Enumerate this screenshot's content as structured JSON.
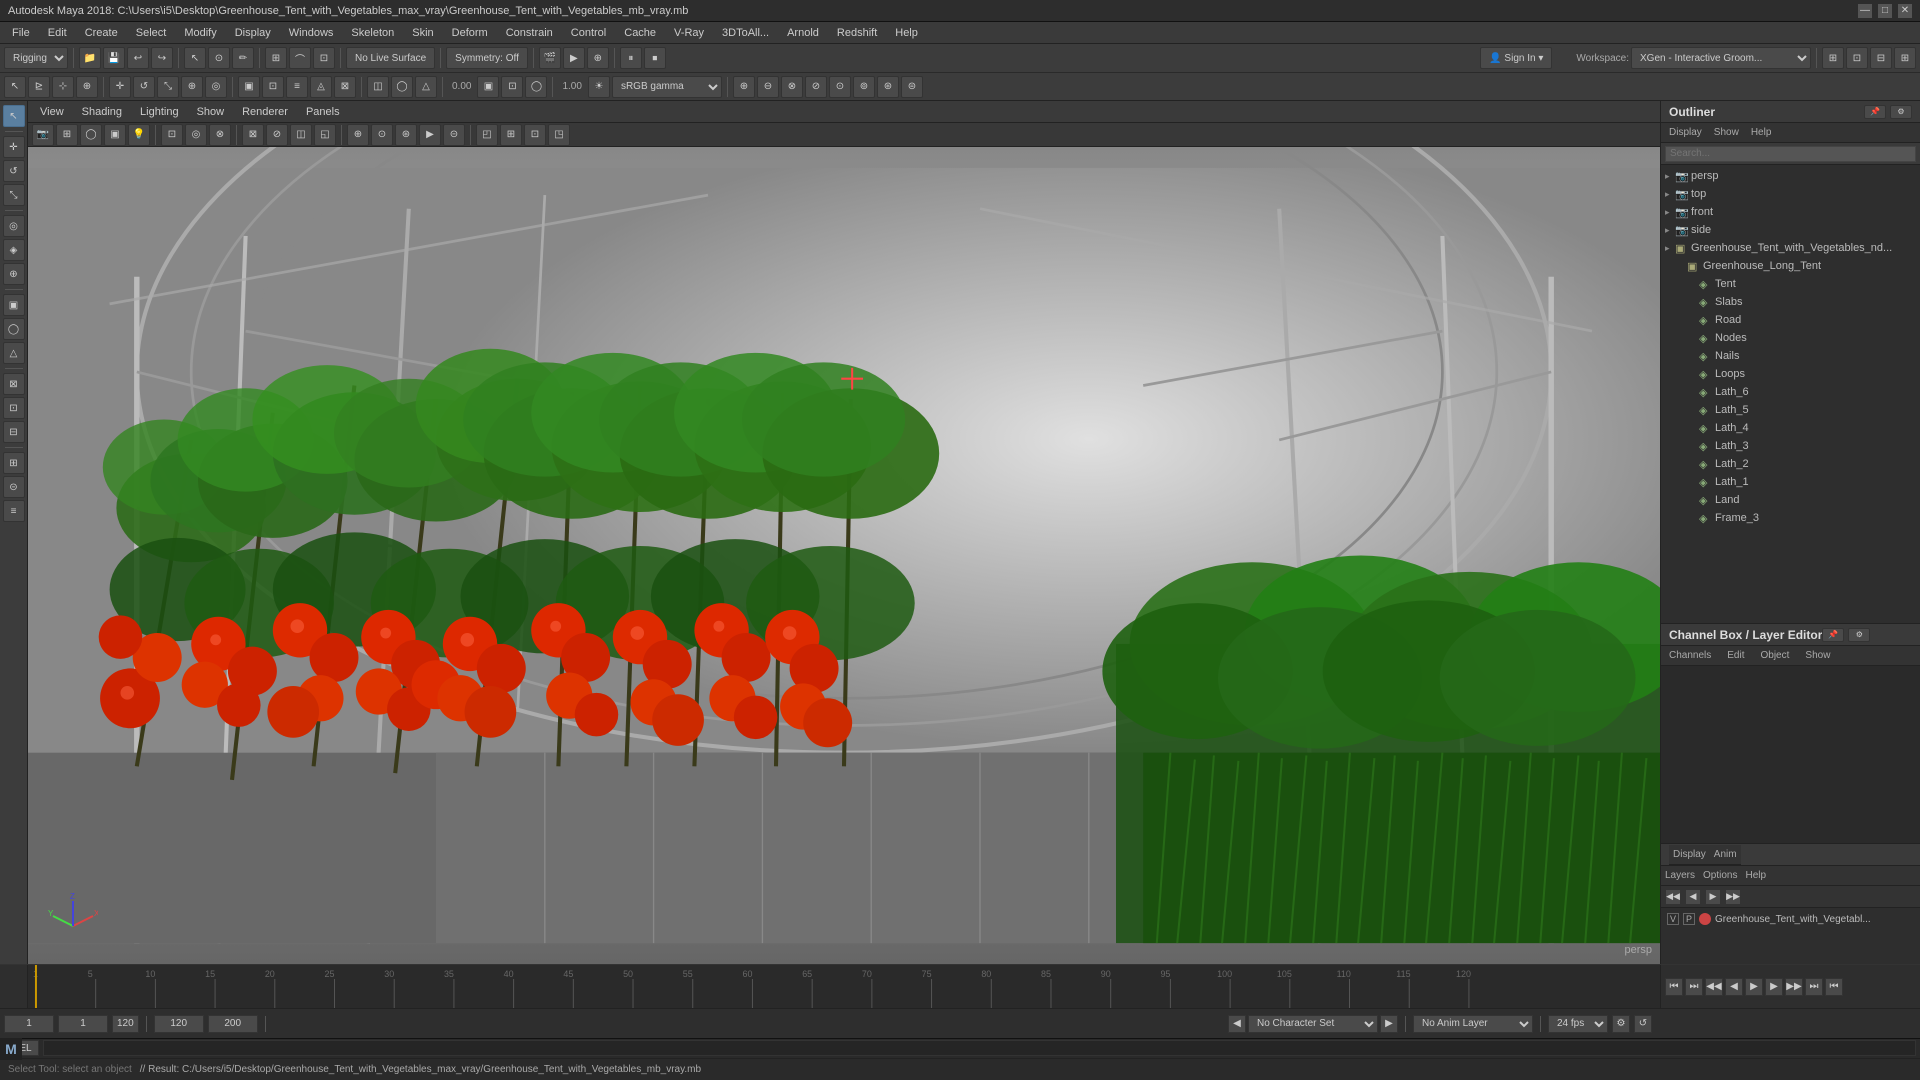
{
  "titlebar": {
    "title": "Autodesk Maya 2018: C:\\Users\\i5\\Desktop\\Greenhouse_Tent_with_Vegetables_max_vray\\Greenhouse_Tent_with_Vegetables_mb_vray.mb",
    "minimize": "—",
    "maximize": "□",
    "close": "✕"
  },
  "menubar": {
    "items": [
      "File",
      "Edit",
      "Create",
      "Select",
      "Modify",
      "Display",
      "Windows",
      "Skeleton",
      "Skin",
      "Deform",
      "Constrain",
      "Control",
      "Cache",
      "V-Ray",
      "3DtoAll...",
      "Arnold",
      "Redshift",
      "Help"
    ]
  },
  "toolbar1": {
    "rigging_label": "Rigging",
    "symmetry_label": "Symmetry: Off",
    "live_surface_label": "No Live Surface",
    "workspace_label": "Workspace:",
    "workspace_value": "XGen - Interactive Groom..."
  },
  "viewport": {
    "menu_items": [
      "View",
      "Shading",
      "Lighting",
      "Show",
      "Renderer",
      "Panels"
    ],
    "label": "persp",
    "camera": "persp"
  },
  "outliner": {
    "title": "Outliner",
    "tabs": [
      "Display",
      "Show",
      "Help"
    ],
    "search_placeholder": "Search...",
    "items": [
      {
        "label": "persp",
        "indent": 0,
        "type": "camera",
        "icon": "📷"
      },
      {
        "label": "top",
        "indent": 0,
        "type": "camera",
        "icon": "📷"
      },
      {
        "label": "front",
        "indent": 0,
        "type": "camera",
        "icon": "📷"
      },
      {
        "label": "side",
        "indent": 0,
        "type": "camera",
        "icon": "📷"
      },
      {
        "label": "Greenhouse_Tent_with_Vegetables_nd...",
        "indent": 0,
        "type": "group",
        "icon": "▣"
      },
      {
        "label": "Greenhouse_Long_Tent",
        "indent": 1,
        "type": "group",
        "icon": "▣"
      },
      {
        "label": "Tent",
        "indent": 2,
        "type": "mesh",
        "icon": "◈"
      },
      {
        "label": "Slabs",
        "indent": 2,
        "type": "mesh",
        "icon": "◈"
      },
      {
        "label": "Road",
        "indent": 2,
        "type": "mesh",
        "icon": "◈"
      },
      {
        "label": "Nodes",
        "indent": 2,
        "type": "mesh",
        "icon": "◈"
      },
      {
        "label": "Nails",
        "indent": 2,
        "type": "mesh",
        "icon": "◈"
      },
      {
        "label": "Loops",
        "indent": 2,
        "type": "mesh",
        "icon": "◈"
      },
      {
        "label": "Lath_6",
        "indent": 2,
        "type": "mesh",
        "icon": "◈"
      },
      {
        "label": "Lath_5",
        "indent": 2,
        "type": "mesh",
        "icon": "◈"
      },
      {
        "label": "Lath_4",
        "indent": 2,
        "type": "mesh",
        "icon": "◈"
      },
      {
        "label": "Lath_3",
        "indent": 2,
        "type": "mesh",
        "icon": "◈"
      },
      {
        "label": "Lath_2",
        "indent": 2,
        "type": "mesh",
        "icon": "◈"
      },
      {
        "label": "Lath_1",
        "indent": 2,
        "type": "mesh",
        "icon": "◈"
      },
      {
        "label": "Land",
        "indent": 2,
        "type": "mesh",
        "icon": "◈"
      },
      {
        "label": "Frame_3",
        "indent": 2,
        "type": "mesh",
        "icon": "◈"
      }
    ]
  },
  "channel_box": {
    "title": "Channel Box / Layer Editor",
    "tabs": [
      "Channels",
      "Edit",
      "Object",
      "Show"
    ]
  },
  "layer_editor": {
    "tabs": [
      "Display",
      "Anim"
    ],
    "sub_tabs": [
      "Layers",
      "Options",
      "Help"
    ],
    "layers": [
      {
        "visible": "V",
        "playback": "P",
        "color": "#cc4444",
        "name": "Greenhouse_Tent_with_Vegetabl..."
      }
    ]
  },
  "timeline": {
    "start": "1",
    "end": "120",
    "current": "1",
    "range_start": "1",
    "range_end": "120",
    "anim_end": "200",
    "fps": "24 fps",
    "ticks": [
      5,
      10,
      15,
      20,
      25,
      30,
      35,
      40,
      45,
      50,
      55,
      60,
      65,
      70,
      75,
      80,
      85,
      90,
      95,
      100,
      105,
      110,
      115,
      120
    ]
  },
  "playback": {
    "buttons": [
      "⏮",
      "⏭",
      "◀◀",
      "◀",
      "▶",
      "▶▶"
    ]
  },
  "statusbar": {
    "mode": "MEL",
    "result_text": "// Result: C:/Users/i5/Desktop/Greenhouse_Tent_with_Vegetables_max_vray/Greenhouse_Tent_with_Vegetables_mb_vray.mb",
    "tool_hint": "Select Tool: select an object",
    "no_character_set": "No Character Set",
    "no_anim_layer": "No Anim Layer",
    "fps": "24 fps"
  },
  "bottom_inputs": {
    "frame_start": "1",
    "frame_current": "1",
    "frame_preview": "120",
    "frame_anim_end": "120",
    "frame_total": "200"
  }
}
